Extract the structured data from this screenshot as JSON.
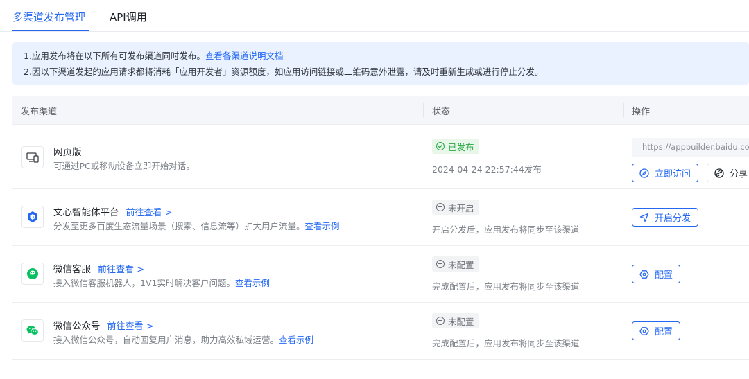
{
  "tabs": [
    {
      "label": "多渠道发布管理",
      "active": true
    },
    {
      "label": "API调用",
      "active": false
    }
  ],
  "notice": {
    "line1_text": "1.应用发布将在以下所有可发布渠道同时发布。",
    "line1_link": "查看各渠道说明文档",
    "line2_text": "2.因以下渠道发起的应用请求都将消耗「应用开发者」资源额度，如应用访问链接或二维码意外泄露，请及时重新生成或进行停止分发。"
  },
  "table": {
    "headers": [
      "发布渠道",
      "状态",
      "操作"
    ]
  },
  "rows": [
    {
      "icon": "monitor-phone-icon",
      "name": "网页版",
      "goto": "",
      "desc": "可通过PC或移动设备立即开始对话。",
      "desc_link": "",
      "status": "已发布",
      "status_kind": "published",
      "status_sub": "2024-04-24 22:57:44发布",
      "url": "https://appbuilder.baidu.com/",
      "actions": [
        "立即访问",
        "分享"
      ]
    },
    {
      "icon": "wenxin-agent-icon",
      "name": "文心智能体平台",
      "goto": "前往查看 >",
      "desc": "分发至更多百度生态流量场景（搜索、信息流等）扩大用户流量。",
      "desc_link": "查看示例",
      "status": "未开启",
      "status_kind": "off",
      "status_sub": "开启分发后，应用发布将同步至该渠道",
      "actions": [
        "开启分发"
      ]
    },
    {
      "icon": "wechat-service-icon",
      "name": "微信客服",
      "goto": "前往查看 >",
      "desc": "接入微信客服机器人，1V1实时解决客户问题。",
      "desc_link": "查看示例",
      "status": "未配置",
      "status_kind": "off",
      "status_sub": "完成配置后，应用发布将同步至该渠道",
      "actions": [
        "配置"
      ]
    },
    {
      "icon": "wechat-official-icon",
      "name": "微信公众号",
      "goto": "前往查看 >",
      "desc": "接入微信公众号，自动回复用户消息，助力高效私域运营。",
      "desc_link": "查看示例",
      "status": "未配置",
      "status_kind": "off",
      "status_sub": "完成配置后，应用发布将同步至该渠道",
      "actions": [
        "配置"
      ]
    }
  ],
  "colors": {
    "accent": "#2468f2",
    "success": "#27a844",
    "notice_bg": "#eaf2ff",
    "wechat_green": "#07c160"
  }
}
